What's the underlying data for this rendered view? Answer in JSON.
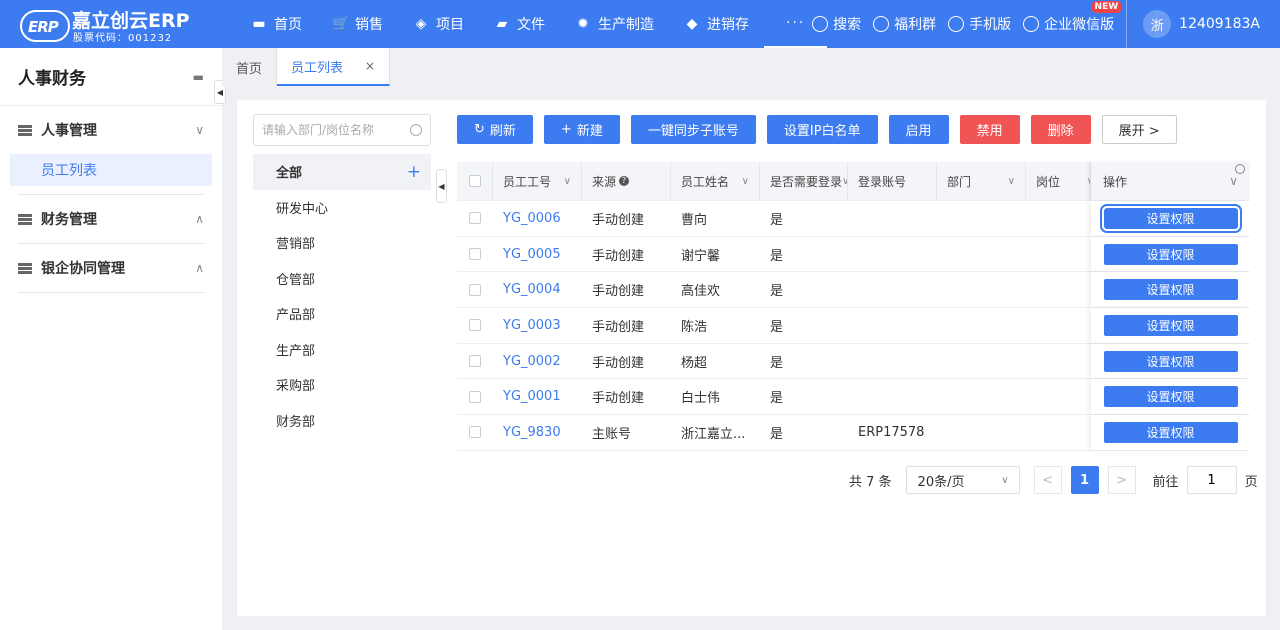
{
  "brand": {
    "logo_text": "ERP",
    "title": "嘉立创云ERP",
    "stock_code": "股票代码：001232"
  },
  "topnav": [
    {
      "label": "首页",
      "icon": "monitor-icon",
      "glyph": "▬"
    },
    {
      "label": "销售",
      "icon": "cart-icon",
      "glyph": "🛒"
    },
    {
      "label": "项目",
      "icon": "layers-icon",
      "glyph": "◈"
    },
    {
      "label": "文件",
      "icon": "folder-icon",
      "glyph": "▰"
    },
    {
      "label": "生产制造",
      "icon": "gear-icon",
      "glyph": "✹"
    },
    {
      "label": "进销存",
      "icon": "cube-icon",
      "glyph": "◆"
    }
  ],
  "topnav_more": "···",
  "topright": [
    {
      "label": "搜索",
      "icon": "search-icon",
      "glyph": "○"
    },
    {
      "label": "福利群",
      "icon": "chat-group-icon",
      "glyph": "◎"
    },
    {
      "label": "手机版",
      "icon": "mobile-icon",
      "glyph": "∅"
    },
    {
      "label": "企业微信版",
      "icon": "wecom-icon",
      "glyph": "◌"
    }
  ],
  "new_badge": "NEW",
  "user": {
    "avatar_text": "浙",
    "name": "12409183A"
  },
  "sidebar": {
    "title": "人事财务",
    "groups": [
      {
        "label": "人事管理",
        "chevron": "∨",
        "items": [
          "员工列表"
        ]
      },
      {
        "label": "财务管理",
        "chevron": "∧",
        "items": []
      },
      {
        "label": "银企协同管理",
        "chevron": "∧",
        "items": []
      }
    ]
  },
  "tabs": [
    {
      "label": "首页"
    },
    {
      "label": "员工列表",
      "close": "×"
    }
  ],
  "tree": {
    "search_placeholder": "请输入部门/岗位名称",
    "items": [
      "全部",
      "研发中心",
      "营销部",
      "仓管部",
      "产品部",
      "生产部",
      "采购部",
      "财务部"
    ],
    "add_glyph": "+"
  },
  "toolbar": {
    "refresh": "刷新",
    "new": "新建",
    "sync": "一键同步子账号",
    "ip_whitelist": "设置IP白名单",
    "enable": "启用",
    "disable": "禁用",
    "delete": "删除",
    "expand": "展开 >"
  },
  "table": {
    "headers": {
      "id": "员工工号",
      "source": "来源",
      "name": "员工姓名",
      "need_login": "是否需要登录",
      "account": "登录账号",
      "dept": "部门",
      "position": "岗位",
      "op": "操作"
    },
    "help_glyph": "?",
    "rows": [
      {
        "id": "YG_0006",
        "source": "手动创建",
        "name": "曹向",
        "need_login": "是",
        "account": "",
        "dept": "",
        "position": "",
        "op": "设置权限"
      },
      {
        "id": "YG_0005",
        "source": "手动创建",
        "name": "谢宁馨",
        "need_login": "是",
        "account": "",
        "dept": "",
        "position": "",
        "op": "设置权限"
      },
      {
        "id": "YG_0004",
        "source": "手动创建",
        "name": "高佳欢",
        "need_login": "是",
        "account": "",
        "dept": "",
        "position": "",
        "op": "设置权限"
      },
      {
        "id": "YG_0003",
        "source": "手动创建",
        "name": "陈浩",
        "need_login": "是",
        "account": "",
        "dept": "",
        "position": "",
        "op": "设置权限"
      },
      {
        "id": "YG_0002",
        "source": "手动创建",
        "name": "杨超",
        "need_login": "是",
        "account": "",
        "dept": "",
        "position": "",
        "op": "设置权限"
      },
      {
        "id": "YG_0001",
        "source": "手动创建",
        "name": "白士伟",
        "need_login": "是",
        "account": "",
        "dept": "",
        "position": "",
        "op": "设置权限"
      },
      {
        "id": "YG_9830",
        "source": "主账号",
        "name": "浙江嘉立...",
        "need_login": "是",
        "account": "ERP17578",
        "dept": "",
        "position": "",
        "op": "设置权限"
      }
    ]
  },
  "pager": {
    "total": "共 7 条",
    "page_size": "20条/页",
    "prev": "<",
    "next": ">",
    "current": "1",
    "goto_label": "前往",
    "goto_value": "1",
    "page_suffix": "页"
  },
  "colors": {
    "primary": "#3d7bf0",
    "danger": "#f05454",
    "badge": "#f04444"
  }
}
